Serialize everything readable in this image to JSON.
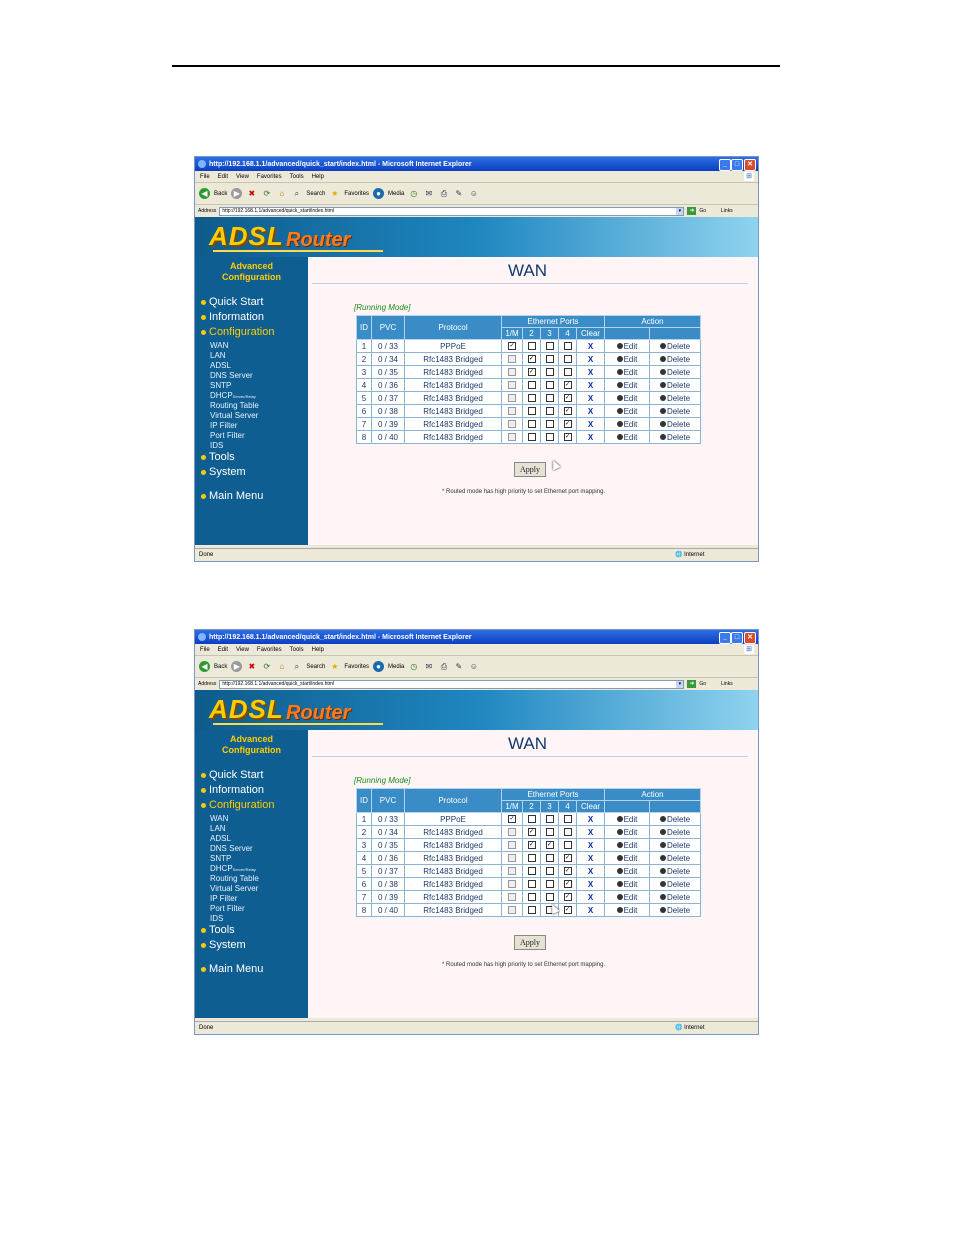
{
  "browser": {
    "title": "http://192.168.1.1/advanced/quick_start/index.html - Microsoft Internet Explorer",
    "menu": [
      "File",
      "Edit",
      "View",
      "Favorites",
      "Tools",
      "Help"
    ],
    "toolbar": {
      "back": "Back",
      "search": "Search",
      "favorites": "Favorites",
      "media": "Media"
    },
    "address_label": "Address",
    "address": "http://192.168.1.1/advanced/quick_start/index.html",
    "go": "Go",
    "links": "Links",
    "status_left": "Done",
    "status_zone": "Internet"
  },
  "banner": {
    "title_a": "ADSL",
    "title_b": "Router"
  },
  "sidebar": {
    "header_line1": "Advanced",
    "header_line2": "Configuration",
    "quick_start": "Quick Start",
    "information": "Information",
    "configuration": "Configuration",
    "sub": [
      "WAN",
      "LAN",
      "ADSL",
      "DNS Server",
      "SNTP",
      "DHCP",
      "Routing Table",
      "Virtual Server",
      "IP Filter",
      "Port Filter",
      "IDS"
    ],
    "dhcp_small": "Server/Relay",
    "tools": "Tools",
    "system": "System",
    "main_menu": "Main Menu"
  },
  "page": {
    "title": "WAN",
    "mode": "[Running Mode]",
    "apply": "Apply",
    "note": "* Routed mode has high priority to set Ethernet port mapping."
  },
  "table": {
    "headers": {
      "id": "ID",
      "pvc": "PVC",
      "protocol": "Protocol",
      "ports": "Ethernet Ports",
      "action": "Action"
    },
    "port_headers": [
      "1/M",
      "2",
      "3",
      "4",
      "Clear"
    ],
    "edit": "Edit",
    "delete": "Delete",
    "clear": "X"
  },
  "screenshots": [
    {
      "rows": [
        {
          "id": "1",
          "pvc": "0 / 33",
          "protocol": "PPPoE",
          "ports": [
            1,
            0,
            0,
            0
          ],
          "disabled": [
            0,
            0,
            0,
            0
          ]
        },
        {
          "id": "2",
          "pvc": "0 / 34",
          "protocol": "Rfc1483 Bridged",
          "ports": [
            0,
            1,
            0,
            0
          ],
          "disabled": [
            1,
            0,
            0,
            0
          ]
        },
        {
          "id": "3",
          "pvc": "0 / 35",
          "protocol": "Rfc1483 Bridged",
          "ports": [
            0,
            1,
            0,
            0
          ],
          "disabled": [
            1,
            0,
            0,
            0
          ]
        },
        {
          "id": "4",
          "pvc": "0 / 36",
          "protocol": "Rfc1483 Bridged",
          "ports": [
            0,
            0,
            0,
            1
          ],
          "disabled": [
            1,
            0,
            0,
            0
          ]
        },
        {
          "id": "5",
          "pvc": "0 / 37",
          "protocol": "Rfc1483 Bridged",
          "ports": [
            0,
            0,
            0,
            1
          ],
          "disabled": [
            1,
            0,
            0,
            0
          ]
        },
        {
          "id": "6",
          "pvc": "0 / 38",
          "protocol": "Rfc1483 Bridged",
          "ports": [
            0,
            0,
            0,
            1
          ],
          "disabled": [
            1,
            0,
            0,
            0
          ]
        },
        {
          "id": "7",
          "pvc": "0 / 39",
          "protocol": "Rfc1483 Bridged",
          "ports": [
            0,
            0,
            0,
            1
          ],
          "disabled": [
            1,
            0,
            0,
            0
          ]
        },
        {
          "id": "8",
          "pvc": "0 / 40",
          "protocol": "Rfc1483 Bridged",
          "ports": [
            0,
            0,
            0,
            1
          ],
          "disabled": [
            1,
            0,
            0,
            0
          ]
        }
      ]
    },
    {
      "rows": [
        {
          "id": "1",
          "pvc": "0 / 33",
          "protocol": "PPPoE",
          "ports": [
            1,
            0,
            0,
            0
          ],
          "disabled": [
            0,
            0,
            0,
            0
          ]
        },
        {
          "id": "2",
          "pvc": "0 / 34",
          "protocol": "Rfc1483 Bridged",
          "ports": [
            0,
            1,
            0,
            0
          ],
          "disabled": [
            1,
            0,
            0,
            0
          ]
        },
        {
          "id": "3",
          "pvc": "0 / 35",
          "protocol": "Rfc1483 Bridged",
          "ports": [
            0,
            1,
            1,
            0
          ],
          "disabled": [
            1,
            0,
            0,
            0
          ]
        },
        {
          "id": "4",
          "pvc": "0 / 36",
          "protocol": "Rfc1483 Bridged",
          "ports": [
            0,
            0,
            0,
            1
          ],
          "disabled": [
            1,
            0,
            0,
            0
          ]
        },
        {
          "id": "5",
          "pvc": "0 / 37",
          "protocol": "Rfc1483 Bridged",
          "ports": [
            0,
            0,
            0,
            1
          ],
          "disabled": [
            1,
            0,
            0,
            0
          ]
        },
        {
          "id": "6",
          "pvc": "0 / 38",
          "protocol": "Rfc1483 Bridged",
          "ports": [
            0,
            0,
            0,
            1
          ],
          "disabled": [
            1,
            0,
            0,
            0
          ]
        },
        {
          "id": "7",
          "pvc": "0 / 39",
          "protocol": "Rfc1483 Bridged",
          "ports": [
            0,
            0,
            0,
            1
          ],
          "disabled": [
            1,
            0,
            0,
            0
          ]
        },
        {
          "id": "8",
          "pvc": "0 / 40",
          "protocol": "Rfc1483 Bridged",
          "ports": [
            0,
            0,
            0,
            1
          ],
          "disabled": [
            1,
            0,
            0,
            0
          ]
        }
      ]
    }
  ],
  "colors": {
    "sidebar": "#0f5e92",
    "table_header": "#3a8cc6",
    "accent": "#ffcc00"
  }
}
